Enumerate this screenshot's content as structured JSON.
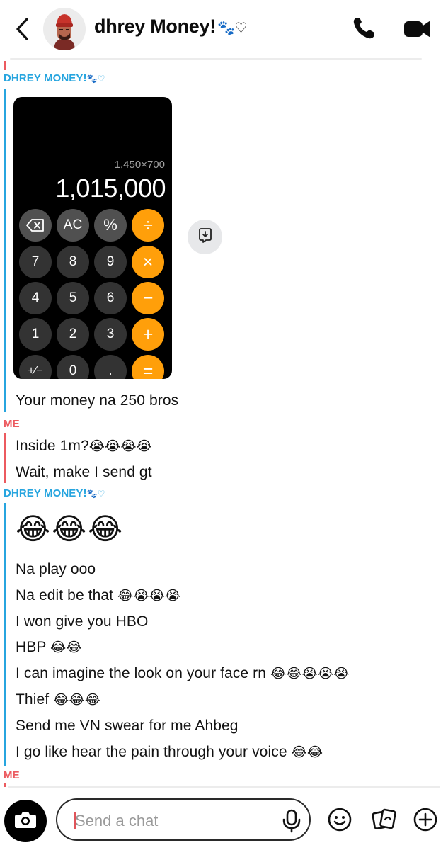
{
  "header": {
    "contact_name": "dhrey Money!",
    "contact_name_suffix": "🐾♡"
  },
  "calculator": {
    "expression": "1,450×700",
    "display": "1,015,000",
    "keys": [
      [
        "⌫",
        "AC",
        "%",
        "÷"
      ],
      [
        "7",
        "8",
        "9",
        "×"
      ],
      [
        "4",
        "5",
        "6",
        "−"
      ],
      [
        "1",
        "2",
        "3",
        "+"
      ],
      [
        "+∕−",
        "0",
        ".",
        "="
      ]
    ]
  },
  "messages": {
    "sender_1": "DHREY MONEY!",
    "sender_1_suffix": "🐾♡",
    "m1": "Your money na 250 bros",
    "sender_2": "ME",
    "m2": "Inside 1m?",
    "m2_emoji": "😭😭😭😭",
    "m3": "Wait, make I send gt",
    "sender_3": "DHREY MONEY!",
    "sender_3_suffix": "🐾♡",
    "big_emoji": "😂😂😂",
    "m4": "Na play ooo",
    "m5": "Na edit be that",
    "m5_emoji": "😂😭😭😭",
    "m6": "I won give you HBO",
    "m7": "HBP",
    "m7_emoji": "😂😂",
    "m8": "I can imagine the look on your face rn",
    "m8_emoji": "😂😂😭😭😭",
    "m9": "Thief",
    "m9_emoji": "😂😂😂",
    "m10": "Send me VN swear for me Ahbeg",
    "m11": "I go like hear the pain through your voice",
    "m11_emoji": "😂😂",
    "sender_4": "ME"
  },
  "composer": {
    "placeholder": "Send a chat"
  },
  "colors": {
    "friend": "#27a5df",
    "me": "#ec5a5f",
    "operator_key": "#ff9f0a"
  },
  "icons": [
    "back-chevron-icon",
    "phone-icon",
    "video-camera-icon",
    "save-to-chat-icon",
    "camera-icon",
    "microphone-icon",
    "smiley-icon",
    "cards-icon",
    "plus-icon"
  ]
}
